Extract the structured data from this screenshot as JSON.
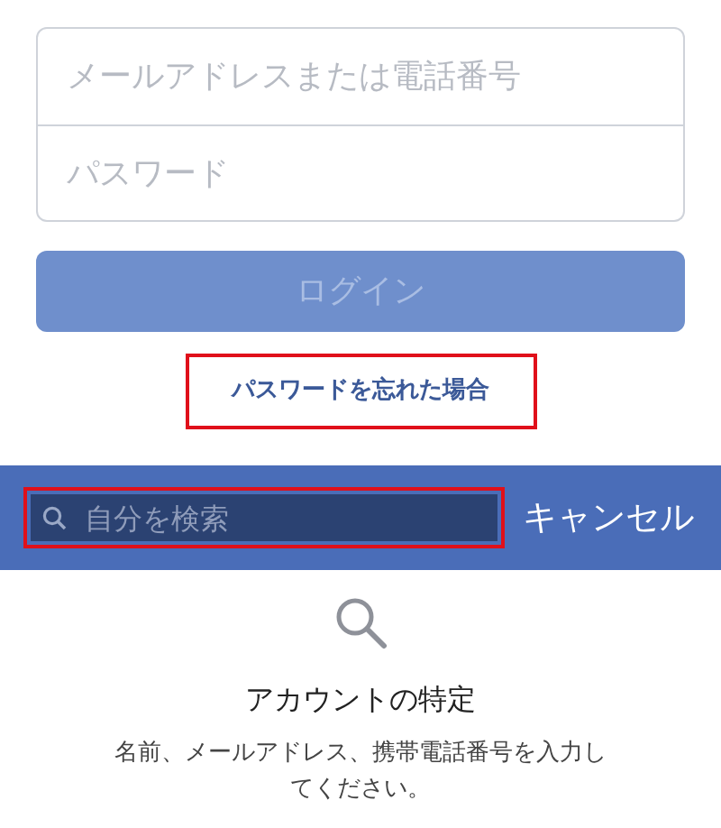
{
  "login_form": {
    "email_field": {
      "placeholder": "メールアドレスまたは電話番号"
    },
    "password_field": {
      "placeholder": "パスワード"
    },
    "login_button": {
      "label": "ログイン",
      "disabled": true
    },
    "forgot_link": {
      "label": "パスワードを忘れた場合",
      "highlighted": true
    }
  },
  "search_bar": {
    "search_field": {
      "placeholder": "自分を検索",
      "highlighted": true
    },
    "cancel_button": {
      "label": "キャンセル"
    }
  },
  "find_account": {
    "title": "アカウントの特定",
    "description": "名前、メールアドレス、携帯電話番号を入力してください。"
  }
}
